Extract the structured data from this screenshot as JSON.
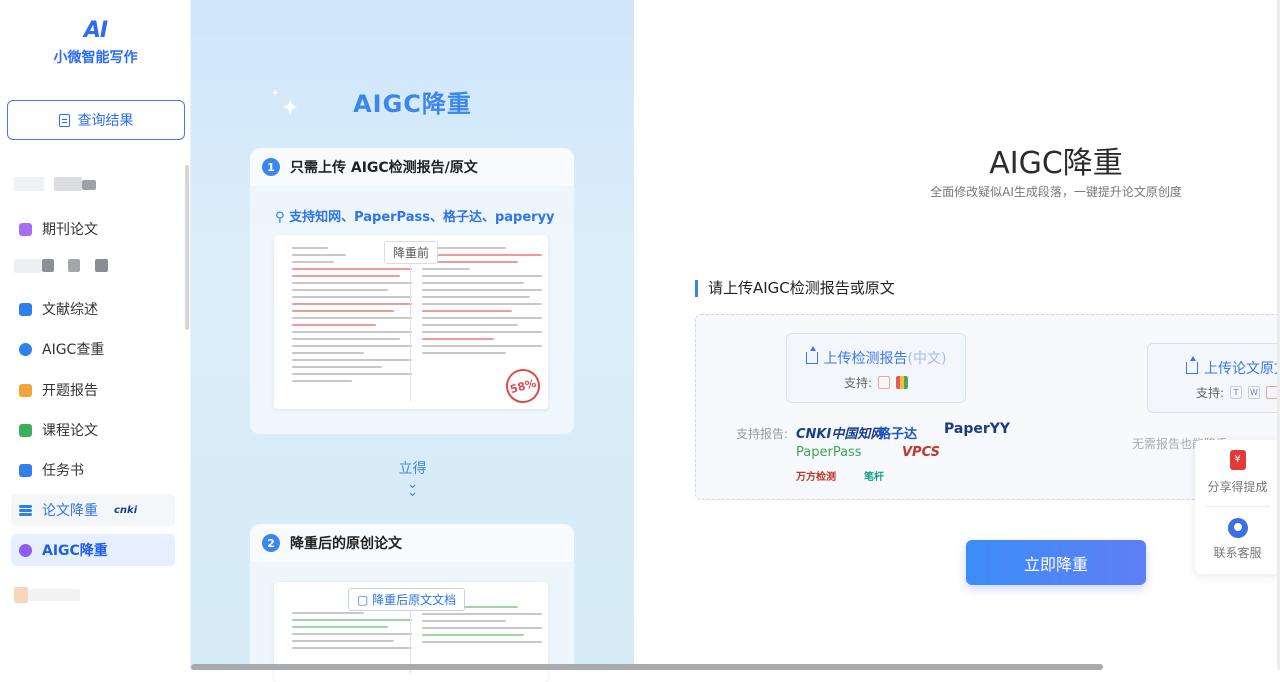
{
  "brand": {
    "mark": "AI",
    "name": "小微智能写作"
  },
  "sidebar": {
    "query_button": "查询结果",
    "items": [
      {
        "label": "期刊论文",
        "color": "#a46df2"
      },
      {
        "label": "文献综述",
        "color": "#2f80ed"
      },
      {
        "label": "AIGC查重",
        "color": "#2f80ed"
      },
      {
        "label": "开题报告",
        "color": "#f2a33a"
      },
      {
        "label": "课程论文",
        "color": "#3cae5c"
      },
      {
        "label": "任务书",
        "color": "#2f80ed"
      },
      {
        "label": "论文降重",
        "color": "#2f80ed",
        "badge": "cnki"
      },
      {
        "label": "AIGC降重",
        "color": "#8b5cf6",
        "active": true
      }
    ]
  },
  "promo": {
    "title": "AIGC降重",
    "step1": {
      "num": "1",
      "title": "只需上传 AIGC检测报告/原文",
      "support": "支持知网、PaperPass、格子达、paperyy",
      "tag": "降重前",
      "score": "58%"
    },
    "arrow_text": "立得",
    "step2": {
      "num": "2",
      "title": "降重后的原创论文",
      "tag": "降重后原文文档"
    }
  },
  "main": {
    "title": "AIGC降重",
    "subtitle": "全面修改疑似AI生成段落，一键提升论文原创度",
    "upload_label": "请上传AIGC检测报告或原文",
    "upload_report": {
      "label": "上传检测报告",
      "hint": "(中文)",
      "support": "支持:"
    },
    "upload_paper": {
      "label": "上传论文原文",
      "support": "支持:"
    },
    "brands_label": "支持报告:",
    "brands": [
      "CNKI中国知网",
      "格子达",
      "PaperYY",
      "PaperPass",
      "VPCS",
      "万方检测",
      "笔杆"
    ],
    "no_report": "无需报告也能降重",
    "cta": "立即降重"
  },
  "float": {
    "share": "分享得提成",
    "service": "联系客服"
  }
}
